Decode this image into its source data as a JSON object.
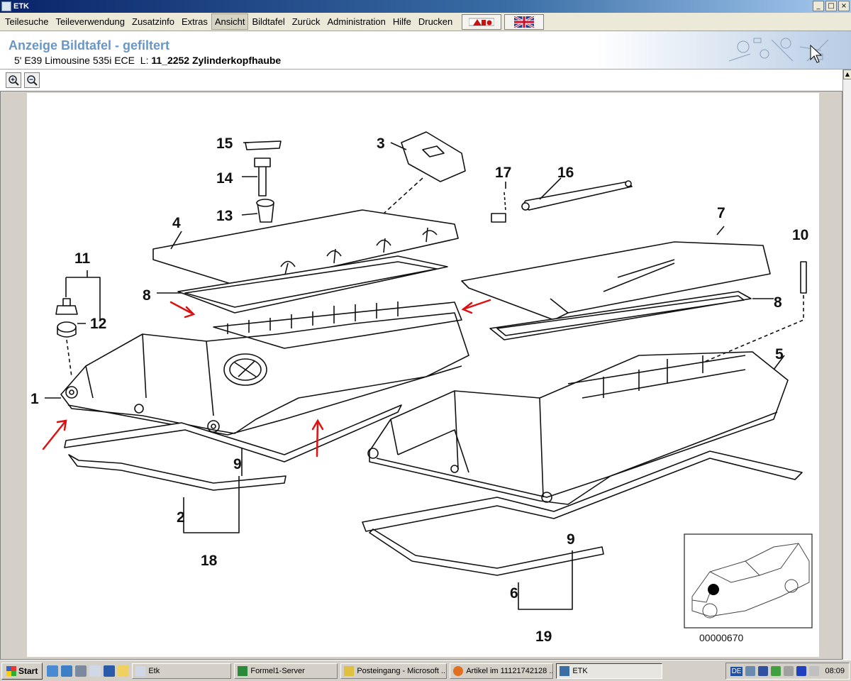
{
  "window": {
    "title": "ETK",
    "min": "_",
    "max": "□",
    "close": "×"
  },
  "menu": {
    "items": [
      {
        "label": "Teilesuche",
        "active": false
      },
      {
        "label": "Teileverwendung",
        "active": false
      },
      {
        "label": "Zusatzinfo",
        "active": false
      },
      {
        "label": "Extras",
        "active": false
      },
      {
        "label": "Ansicht",
        "active": true
      },
      {
        "label": "Bildtafel",
        "active": false
      },
      {
        "label": "Zurück",
        "active": false
      },
      {
        "label": "Administration",
        "active": false
      },
      {
        "label": "Hilfe",
        "active": false
      },
      {
        "label": "Drucken",
        "active": false
      }
    ],
    "flag1_icon": "bmw-aos-flag-icon",
    "flag2_icon": "uk-flag-icon"
  },
  "header": {
    "title": "Anzeige Bildtafel - gefiltert",
    "vehicle": "5' E39 Limousine 535i ECE",
    "l_prefix": "L:",
    "group": "11_2252 Zylinderkopfhaube"
  },
  "toolbar": {
    "zoom_in_icon": "zoom-in-icon",
    "zoom_out_icon": "zoom-out-icon"
  },
  "diagram": {
    "part_labels": [
      "1",
      "2",
      "3",
      "4",
      "5",
      "6",
      "7",
      "8",
      "8",
      "9",
      "9",
      "10",
      "11",
      "12",
      "13",
      "14",
      "15",
      "16",
      "17",
      "18",
      "19"
    ],
    "image_number": "00000670"
  },
  "taskbar": {
    "start": "Start",
    "tasks": [
      {
        "label": "Etk",
        "active": false
      },
      {
        "label": "Formel1-Server",
        "active": false
      },
      {
        "label": "Posteingang - Microsoft ...",
        "active": false
      },
      {
        "label": "Artikel im 11121742128 ...",
        "active": false
      },
      {
        "label": "ETK",
        "active": true
      }
    ],
    "lang": "DE",
    "clock": "08:09"
  },
  "colors": {
    "title_blue": "#6a96c6",
    "arrow_red": "#dd1111"
  }
}
